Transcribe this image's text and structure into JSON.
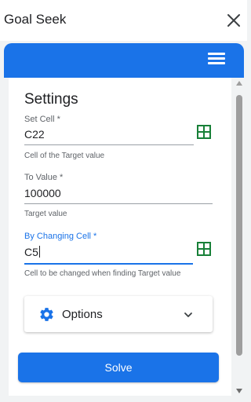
{
  "window": {
    "title": "Goal Seek"
  },
  "panel": {
    "title": "Settings"
  },
  "fields": {
    "set_cell": {
      "label": "Set Cell *",
      "value": "C22",
      "helper": "Cell of the Target value"
    },
    "to_value": {
      "label": "To Value *",
      "value": "100000",
      "helper": "Target value"
    },
    "changing_cell": {
      "label": "By Changing Cell *",
      "value": "C5",
      "helper": "Cell to be changed when finding Target value"
    }
  },
  "options": {
    "label": "Options"
  },
  "actions": {
    "solve_label": "Solve"
  },
  "colors": {
    "accent": "#1a73e8",
    "range_icon": "#188038",
    "background": "#f1f3f4"
  },
  "icons": {
    "close": "close-icon",
    "menu": "hamburger-menu-icon",
    "range": "grid-range-icon",
    "options": "gear-icon",
    "expand": "chevron-down-icon"
  }
}
